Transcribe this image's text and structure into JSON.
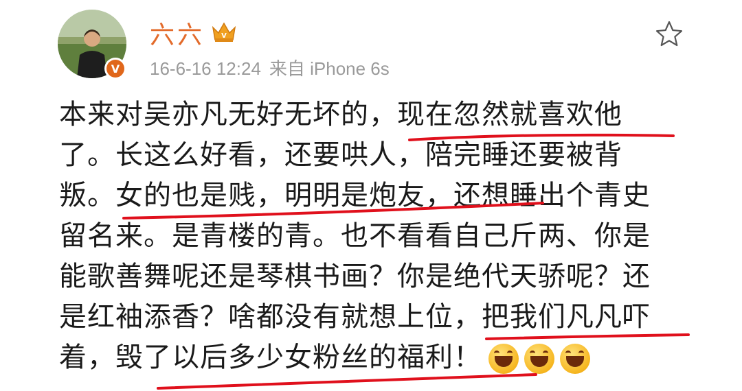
{
  "user": {
    "name": "六六",
    "avatar_icon": "avatar-photo",
    "verified_icon": "verified-v-icon",
    "vip_icon": "vip-crown-icon"
  },
  "meta": {
    "date": "16-6-16 12:24",
    "source": "来自 iPhone 6s"
  },
  "actions": {
    "favorite_icon": "star-outline-icon"
  },
  "post": {
    "lines": [
      " 本来对吴亦凡无好无坏的，现在忽然就喜欢他",
      "了。长这么好看，还要哄人，陪完睡还要被背",
      "叛。女的也是贱，明明是炮友，还想睡出个青史",
      "留名来。是青楼的青。也不看看自己斤两、你是",
      "能歌善舞呢还是琴棋书画？你是绝代天骄呢？还",
      "是红袖添香？啥都没有就想上位，把我们凡凡吓",
      "着，毁了以后多少女粉丝的福利！"
    ],
    "emojis": [
      "laughing-emoji",
      "laughing-emoji",
      "laughing-emoji"
    ]
  },
  "colors": {
    "username": "#e36b2b",
    "underline": "#e0101c",
    "meta": "#9a9a9a"
  }
}
